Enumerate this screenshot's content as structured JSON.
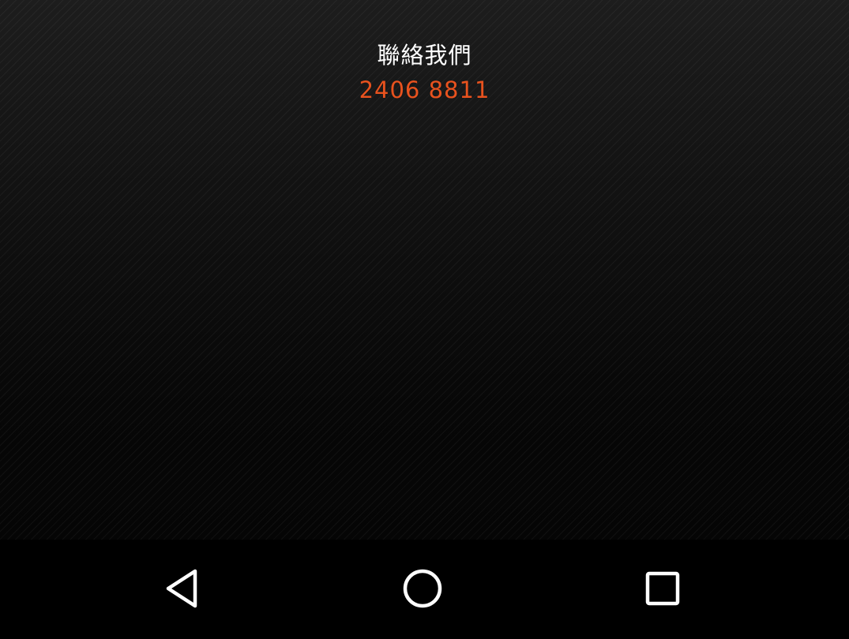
{
  "contact": {
    "title": "聯絡我們",
    "phone": "2406 8811",
    "phone_color": "#e8521e"
  },
  "navigation_bar": {
    "buttons": [
      {
        "name": "back",
        "icon": "triangle-back-icon"
      },
      {
        "name": "home",
        "icon": "circle-home-icon"
      },
      {
        "name": "recents",
        "icon": "square-recents-icon"
      }
    ]
  }
}
